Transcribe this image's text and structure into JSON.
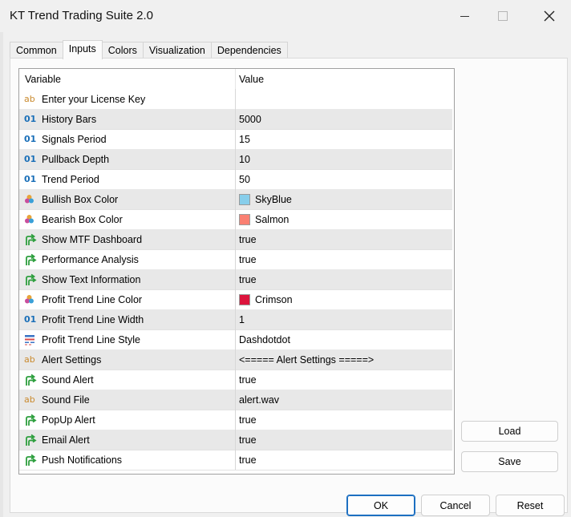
{
  "window": {
    "title": "KT Trend Trading Suite 2.0"
  },
  "tabs": [
    "Common",
    "Inputs",
    "Colors",
    "Visualization",
    "Dependencies"
  ],
  "table": {
    "headers": {
      "variable": "Variable",
      "value": "Value"
    },
    "rows": [
      {
        "icon": "string-icon",
        "variable": "Enter your License Key",
        "value": ""
      },
      {
        "icon": "integer-icon",
        "variable": "History Bars",
        "value": "5000"
      },
      {
        "icon": "integer-icon",
        "variable": "Signals Period",
        "value": "15"
      },
      {
        "icon": "integer-icon",
        "variable": "Pullback Depth",
        "value": "10"
      },
      {
        "icon": "integer-icon",
        "variable": "Trend Period",
        "value": "50"
      },
      {
        "icon": "color-icon",
        "variable": "Bullish Box Color",
        "value": "SkyBlue",
        "color": "#87ceeb"
      },
      {
        "icon": "color-icon",
        "variable": "Bearish Box Color",
        "value": "Salmon",
        "color": "#fa8072"
      },
      {
        "icon": "bool-icon",
        "variable": "Show MTF Dashboard",
        "value": "true"
      },
      {
        "icon": "bool-icon",
        "variable": "Performance Analysis",
        "value": "true"
      },
      {
        "icon": "bool-icon",
        "variable": "Show Text Information",
        "value": "true"
      },
      {
        "icon": "color-icon",
        "variable": "Profit Trend Line Color",
        "value": "Crimson",
        "color": "#dc143c"
      },
      {
        "icon": "integer-icon",
        "variable": "Profit Trend Line Width",
        "value": "1"
      },
      {
        "icon": "linestyle-icon",
        "variable": "Profit Trend Line Style",
        "value": "Dashdotdot"
      },
      {
        "icon": "string-icon",
        "variable": "Alert Settings",
        "value": "<===== Alert Settings =====>"
      },
      {
        "icon": "bool-icon",
        "variable": "Sound Alert",
        "value": "true"
      },
      {
        "icon": "string-icon",
        "variable": "Sound File",
        "value": "alert.wav"
      },
      {
        "icon": "bool-icon",
        "variable": "PopUp Alert",
        "value": "true"
      },
      {
        "icon": "bool-icon",
        "variable": "Email Alert",
        "value": "true"
      },
      {
        "icon": "bool-icon",
        "variable": "Push Notifications",
        "value": "true"
      }
    ]
  },
  "side_buttons": {
    "load": "Load",
    "save": "Save"
  },
  "footer_buttons": {
    "ok": "OK",
    "cancel": "Cancel",
    "reset": "Reset"
  }
}
